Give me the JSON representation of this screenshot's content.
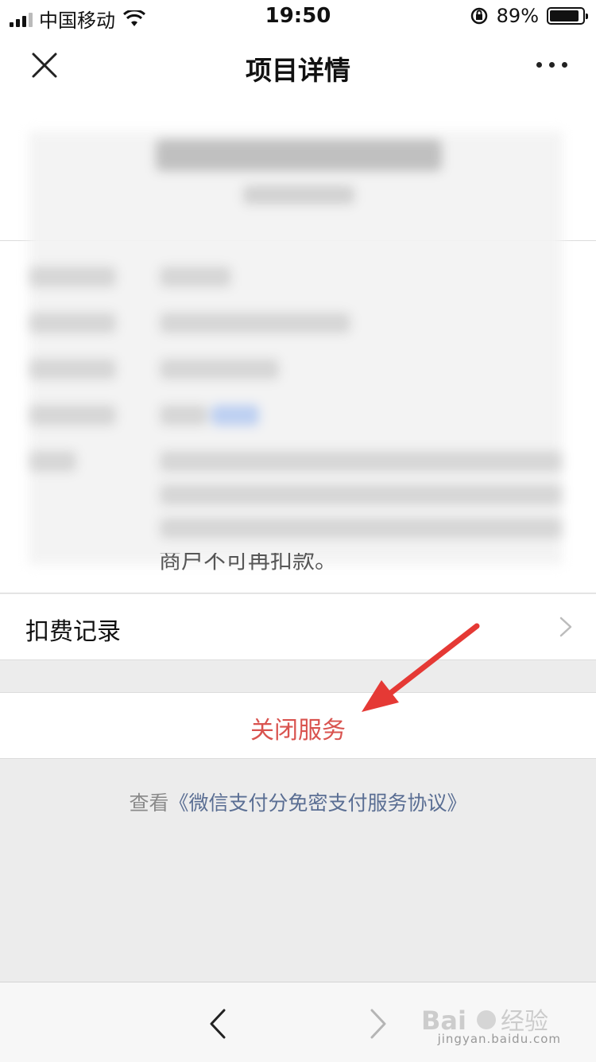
{
  "status_bar": {
    "carrier": "中国移动",
    "time": "19:50",
    "battery_text": "89%",
    "battery_level": 0.89
  },
  "nav": {
    "title": "项目详情"
  },
  "detail_tail_text": "商户不可再扣款。",
  "records_row": {
    "label": "扣费记录"
  },
  "close_service": {
    "label": "关闭服务"
  },
  "agreement": {
    "prefix": "查看",
    "link": "《微信支付分免密支付服务协议》"
  },
  "watermark": {
    "text": "jingyan.baidu.com"
  },
  "colors": {
    "close_red": "#d9534f",
    "link_blue": "#5a6e93",
    "arrow_red": "#e53935"
  },
  "icons": {
    "close": "close-icon",
    "more": "more-dots-icon",
    "chevron": "chevron-right-icon",
    "back": "back-arrow-icon",
    "forward": "forward-arrow-icon"
  }
}
